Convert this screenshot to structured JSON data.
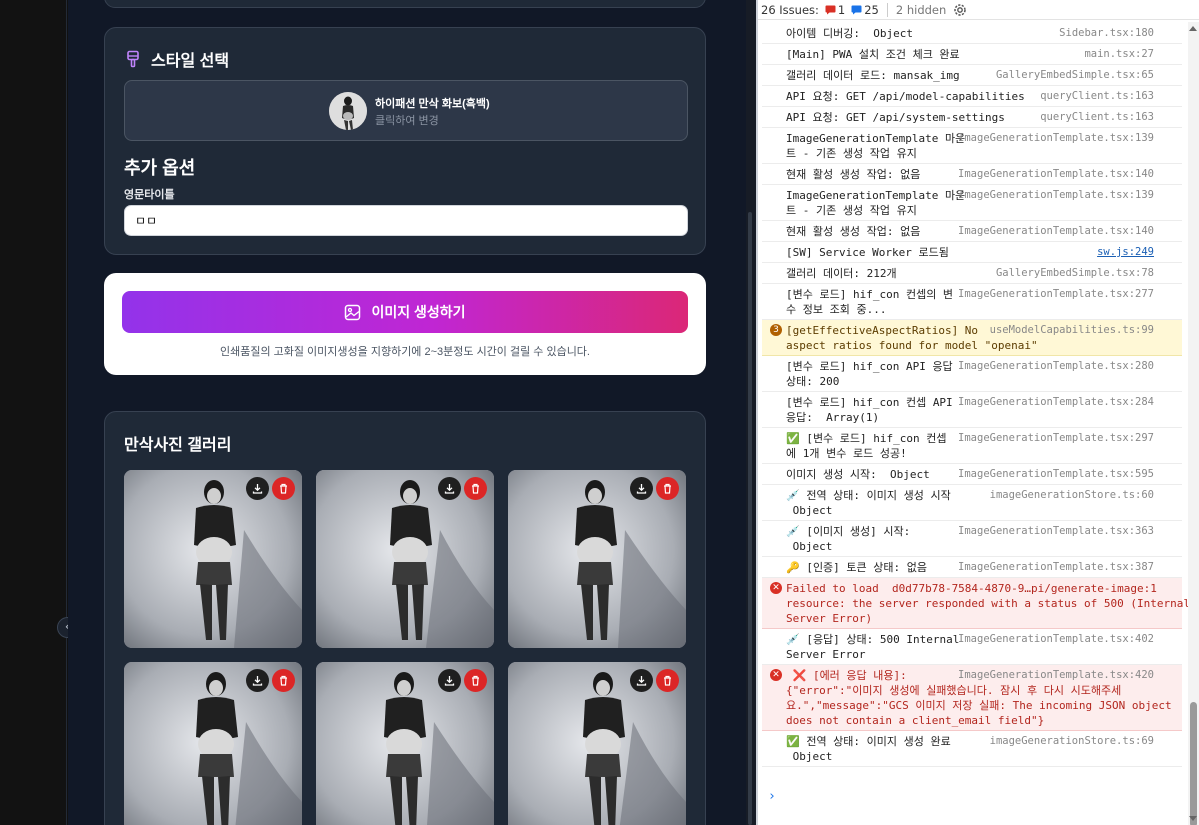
{
  "style_section": {
    "title": "스타일 선택",
    "selected_style_name": "하이패션 만삭 화보(흑백)",
    "selected_style_hint": "클릭하여 변경"
  },
  "extra_options": {
    "title": "추가 옵션",
    "field_label": "영문타이틀",
    "field_value": "ㅁㅁ"
  },
  "generate": {
    "button_label": "이미지 생성하기",
    "note": "인쇄품질의 고화질 이미지생성을 지향하기에 2~3분정도 시간이 걸릴 수 있습니다."
  },
  "gallery": {
    "title": "만삭사진 갤러리",
    "photo_count_visible": 6
  },
  "devtools": {
    "issues_label": "26 Issues:",
    "error_count": "1",
    "message_count": "25",
    "hidden_label": "2 hidden",
    "logs": [
      {
        "msg": "아이템 디버깅:  Object",
        "src": "Sidebar.tsx:180"
      },
      {
        "msg": "[Main] PWA 설치 조건 체크 완료",
        "src": "main.tsx:27"
      },
      {
        "msg": "갤러리 데이터 로드: mansak_img",
        "src": "GalleryEmbedSimple.tsx:65"
      },
      {
        "msg": "API 요청: GET /api/model-capabilities",
        "src": "queryClient.ts:163"
      },
      {
        "msg": "API 요청: GET /api/system-settings",
        "src": "queryClient.ts:163"
      },
      {
        "msg": "ImageGenerationTemplate 마운\n트 - 기존 생성 작업 유지",
        "src": "ImageGenerationTemplate.tsx:139"
      },
      {
        "msg": "현재 활성 생성 작업: 없음",
        "src": "ImageGenerationTemplate.tsx:140"
      },
      {
        "msg": "ImageGenerationTemplate 마운\n트 - 기존 생성 작업 유지",
        "src": "ImageGenerationTemplate.tsx:139"
      },
      {
        "msg": "현재 활성 생성 작업: 없음",
        "src": "ImageGenerationTemplate.tsx:140"
      },
      {
        "msg": "[SW] Service Worker 로드됨",
        "src": "sw.js:249"
      },
      {
        "msg": "갤러리 데이터: 212개",
        "src": "GalleryEmbedSimple.tsx:78"
      },
      {
        "msg": "[변수 로드] hif_con 컨셉의 변\n수 정보 조회 중...",
        "src": "ImageGenerationTemplate.tsx:277"
      },
      {
        "msg": "[getEffectiveAspectRatios] No\naspect ratios found for model \"openai\"",
        "src": "useModelCapabilities.ts:99",
        "count": "3"
      },
      {
        "msg": "[변수 로드] hif_con API 응답\n상태: 200",
        "src": "ImageGenerationTemplate.tsx:280"
      },
      {
        "msg": "[변수 로드] hif_con 컨셉 API\n응답:  Array(1)",
        "src": "ImageGenerationTemplate.tsx:284"
      },
      {
        "msg": "✅ [변수 로드] hif_con 컨셉\n에 1개 변수 로드 성공!",
        "src": "ImageGenerationTemplate.tsx:297"
      },
      {
        "msg": "이미지 생성 시작:  Object",
        "src": "ImageGenerationTemplate.tsx:595"
      },
      {
        "msg": "💉 전역 상태: 이미지 생성 시작\n Object",
        "src": "imageGenerationStore.ts:60"
      },
      {
        "msg": "💉 [이미지 생성] 시작:\n Object",
        "src": "ImageGenerationTemplate.tsx:363"
      },
      {
        "msg": "🔑 [인증] 토큰 상태: 없음",
        "src": "ImageGenerationTemplate.tsx:387"
      },
      {
        "msg": "Failed to load  d0d77b78-7584-4870-9…pi/generate-image:1\nresource: the server responded with a status of 500 (Internal\nServer Error)",
        "src": ""
      },
      {
        "msg": "💉 [응답] 상태: 500 Internal\nServer Error",
        "src": "ImageGenerationTemplate.tsx:402"
      },
      {
        "msg": " ❌ [에러 응답 내용]:\n{\"error\":\"이미지 생성에 실패했습니다. 잠시 후 다시 시도해주세\n요.\",\"message\":\"GCS 이미지 저장 실패: The incoming JSON object\ndoes not contain a client_email field\"}",
        "src": "ImageGenerationTemplate.tsx:420"
      },
      {
        "msg": "✅ 전역 상태: 이미지 생성 완료\n Object",
        "src": "imageGenerationStore.ts:69"
      }
    ],
    "prompt_symbol": "›"
  },
  "colors": {
    "app_bg": "#111827",
    "card_bg": "#1f2937",
    "gradient_start": "#9333ea",
    "gradient_end": "#db2777",
    "delete_red": "#dc2626",
    "console_error_bg": "#fdeded",
    "console_warn_bg": "#fff8d6"
  },
  "icons": [
    "palette-icon",
    "image-icon",
    "download-icon",
    "trash-icon",
    "gear-icon",
    "chevron-left-icon"
  ]
}
